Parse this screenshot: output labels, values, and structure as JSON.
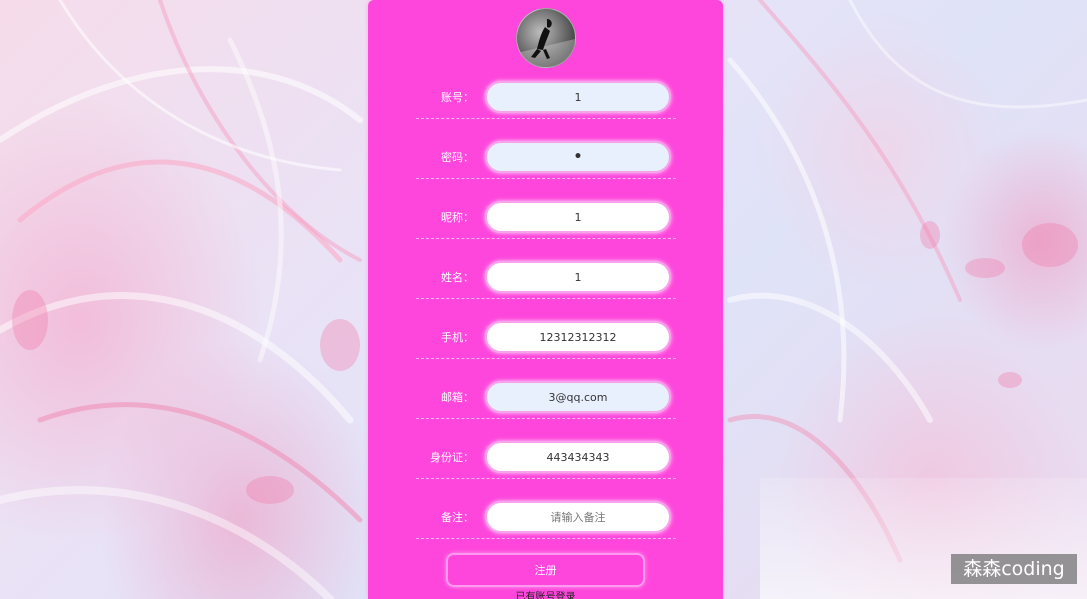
{
  "form": {
    "fields": [
      {
        "label": "账号：",
        "value": "1",
        "placeholder": "",
        "type": "text"
      },
      {
        "label": "密码：",
        "value": "•",
        "placeholder": "",
        "type": "text"
      },
      {
        "label": "昵称：",
        "value": "1",
        "placeholder": "",
        "type": "text"
      },
      {
        "label": "姓名：",
        "value": "1",
        "placeholder": "",
        "type": "text"
      },
      {
        "label": "手机：",
        "value": "12312312312",
        "placeholder": "",
        "type": "text"
      },
      {
        "label": "邮箱：",
        "value": "3@qq.com",
        "placeholder": "",
        "type": "text"
      },
      {
        "label": "身份证：",
        "value": "443434343",
        "placeholder": "",
        "type": "text"
      },
      {
        "label": "备注：",
        "value": "",
        "placeholder": "请输入备注",
        "type": "text"
      }
    ],
    "submit_label": "注册",
    "login_link": "已有账号登录"
  },
  "watermark": "森森coding",
  "colors": {
    "card_background": "#ff46dc",
    "input_border": "#f7a2ec",
    "autofill_background": "#e8f0fe"
  }
}
